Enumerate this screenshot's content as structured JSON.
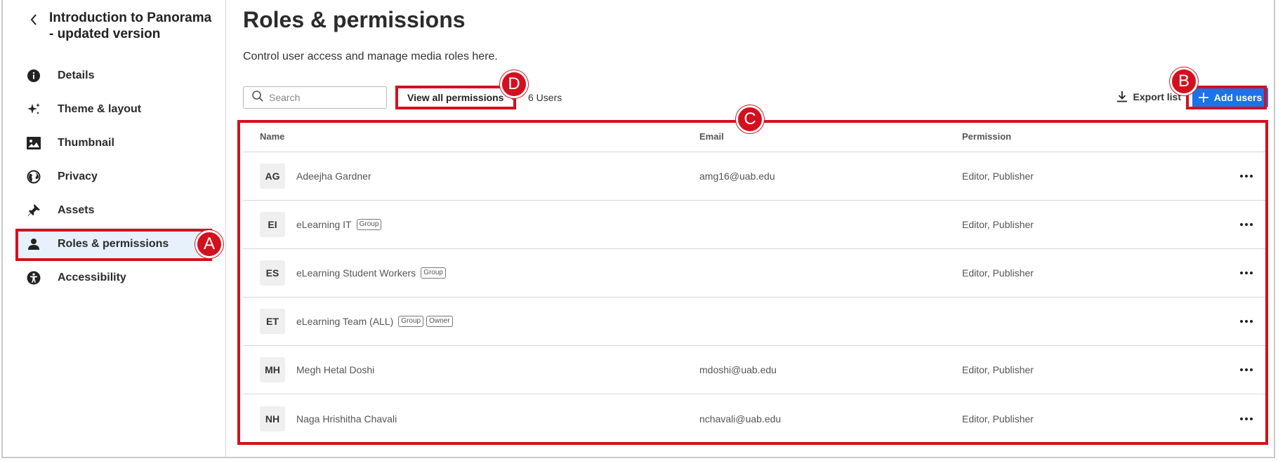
{
  "sidebar": {
    "back_title": "Introduction to Panorama - updated version",
    "items": [
      {
        "label": "Details",
        "icon": "info-icon"
      },
      {
        "label": "Theme & layout",
        "icon": "sparkle-icon"
      },
      {
        "label": "Thumbnail",
        "icon": "image-icon"
      },
      {
        "label": "Privacy",
        "icon": "globe-icon"
      },
      {
        "label": "Assets",
        "icon": "pin-icon"
      },
      {
        "label": "Roles & permissions",
        "icon": "person-icon",
        "active": true
      },
      {
        "label": "Accessibility",
        "icon": "accessibility-icon"
      }
    ]
  },
  "main": {
    "title": "Roles & permissions",
    "subtitle": "Control user access and manage media roles here.",
    "search_placeholder": "Search",
    "permission_filter": "View all permissions",
    "user_count": "6 Users",
    "export_label": "Export list",
    "add_label": "Add users"
  },
  "table": {
    "columns": [
      "Name",
      "Email",
      "Permission"
    ],
    "rows": [
      {
        "initials": "AG",
        "name": "Adeejha Gardner",
        "badges": [],
        "email": "amg16@uab.edu",
        "permission": "Editor, Publisher"
      },
      {
        "initials": "EI",
        "name": "eLearning IT",
        "badges": [
          "Group"
        ],
        "email": "",
        "permission": "Editor, Publisher"
      },
      {
        "initials": "ES",
        "name": "eLearning Student Workers",
        "badges": [
          "Group"
        ],
        "email": "",
        "permission": "Editor, Publisher"
      },
      {
        "initials": "ET",
        "name": "eLearning Team (ALL)",
        "badges": [
          "Group",
          "Owner"
        ],
        "email": "",
        "permission": ""
      },
      {
        "initials": "MH",
        "name": "Megh Hetal Doshi",
        "badges": [],
        "email": "mdoshi@uab.edu",
        "permission": "Editor, Publisher"
      },
      {
        "initials": "NH",
        "name": "Naga Hrishitha Chavali",
        "badges": [],
        "email": "nchavali@uab.edu",
        "permission": "Editor, Publisher"
      }
    ]
  },
  "annotations": {
    "a": "A",
    "b": "B",
    "c": "C",
    "d": "D"
  },
  "colors": {
    "accent": "#1a73e8",
    "annotation": "#d3101e",
    "active_bg": "#e7f1fb"
  }
}
